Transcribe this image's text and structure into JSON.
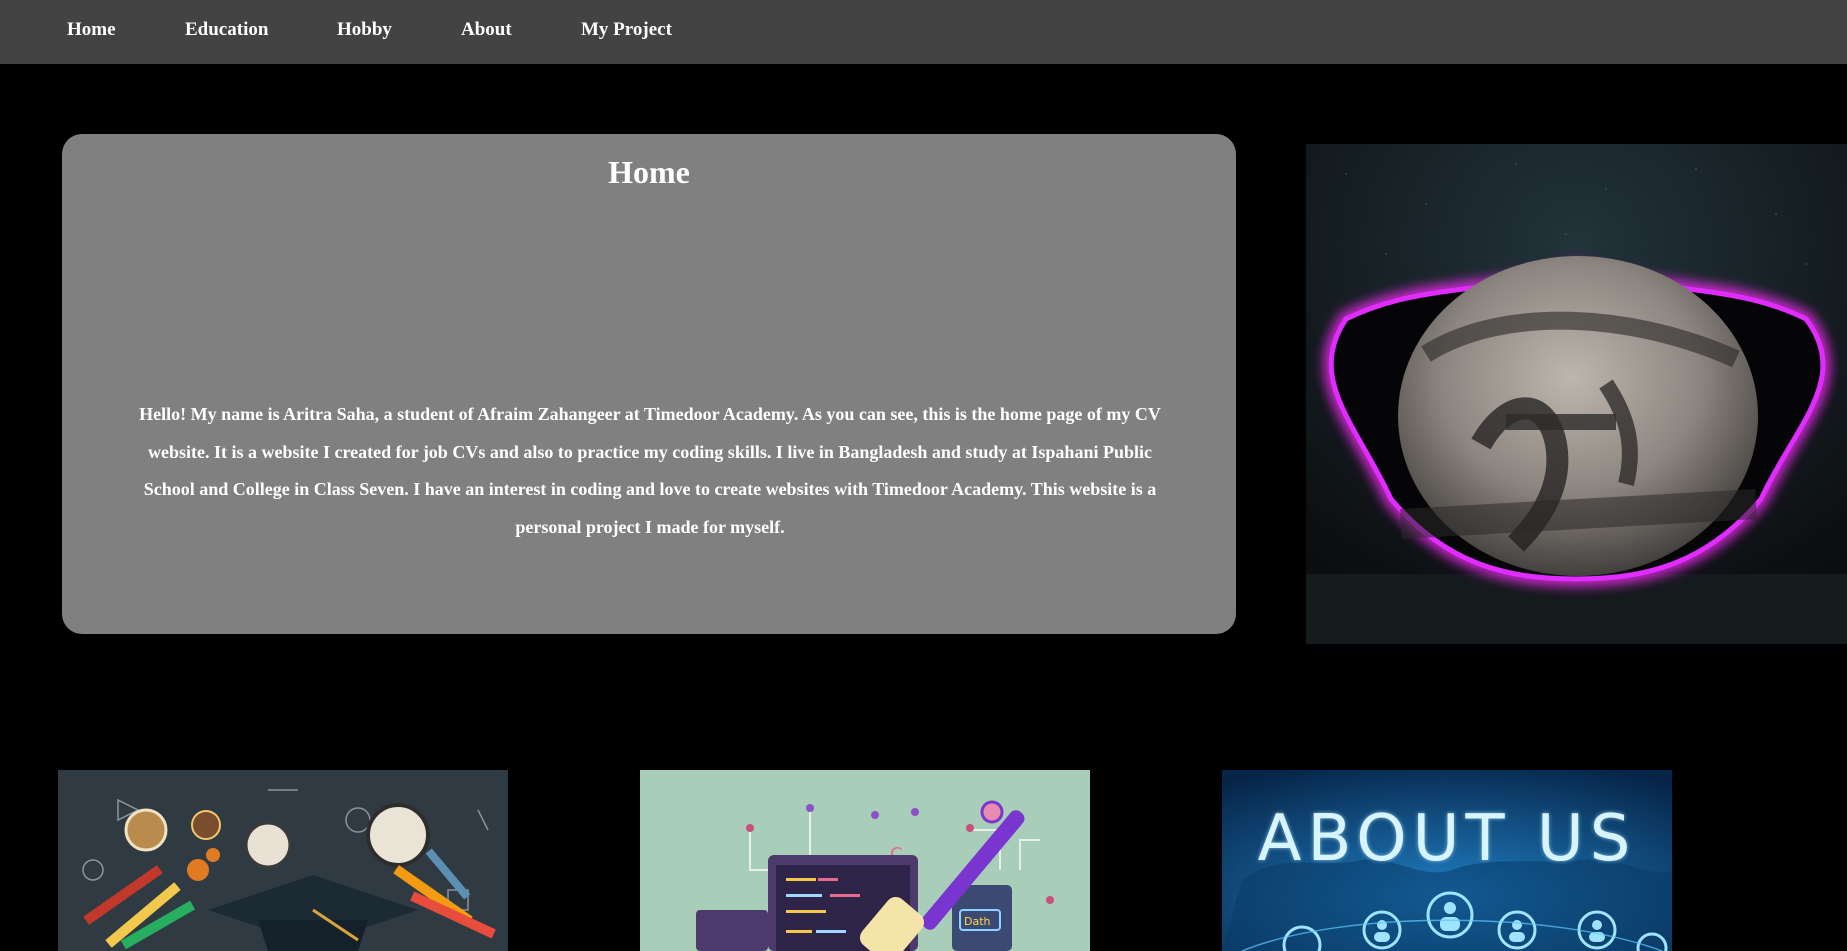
{
  "nav": {
    "items": [
      {
        "label": "Home"
      },
      {
        "label": "Education"
      },
      {
        "label": "Hobby"
      },
      {
        "label": "About"
      },
      {
        "label": "My Project"
      }
    ]
  },
  "home_panel": {
    "title": "Home",
    "text": "Hello! My name is Aritra Saha, a student of Afraim Zahangeer at Timedoor Academy. As you can see, this is the home page of my CV website. It is a website I created for job CVs and also to practice my coding skills. I live in Bangladesh and study at Ispahani Public School and College in Class Seven. I have an interest in coding and love to create websites with Timedoor Academy. This website is a personal project I made for myself."
  },
  "cards": {
    "hobby_image_text": "Dath",
    "about_image_text": "ABOUT US"
  },
  "colors": {
    "background": "#000000",
    "navbar": "#434343",
    "panel": "#808080",
    "text": "#ffffff",
    "visualizer_glow": "#ff2bff",
    "about_text_glow": "#a8e6ff"
  }
}
